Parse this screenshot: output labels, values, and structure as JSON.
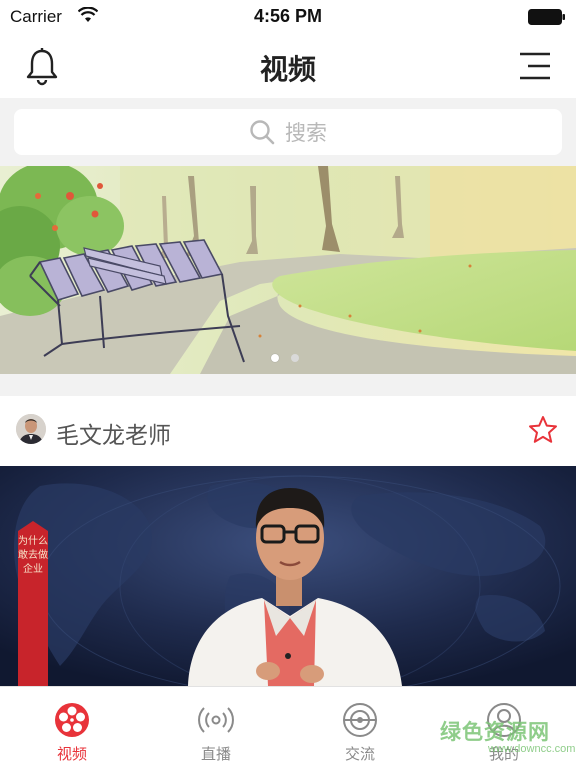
{
  "status_bar": {
    "carrier": "Carrier",
    "time": "4:56 PM"
  },
  "nav": {
    "title": "视频",
    "left_icon": "bell-icon",
    "right_icon": "menu-icon"
  },
  "search": {
    "placeholder": "搜索",
    "icon": "search-icon"
  },
  "banner": {
    "image": "park-bench-painting",
    "page_count": 2,
    "active_page": 1
  },
  "post": {
    "author": "毛文龙老师",
    "favorite_icon": "star-icon",
    "accent_color": "#e8333a",
    "video_banner_text": "为什么敢去做企业"
  },
  "tabs": [
    {
      "label": "视频",
      "icon": "film-reel-icon",
      "active": true
    },
    {
      "label": "直播",
      "icon": "broadcast-icon",
      "active": false
    },
    {
      "label": "交流",
      "icon": "orbit-icon",
      "active": false
    },
    {
      "label": "我的",
      "icon": "user-icon",
      "active": false
    }
  ],
  "colors": {
    "active_tab": "#e8333a",
    "inactive_tab": "#8a8a8a",
    "background": "#f2f2f2"
  },
  "watermark": {
    "main": "绿色资源网",
    "sub": "www.downcc.com"
  }
}
